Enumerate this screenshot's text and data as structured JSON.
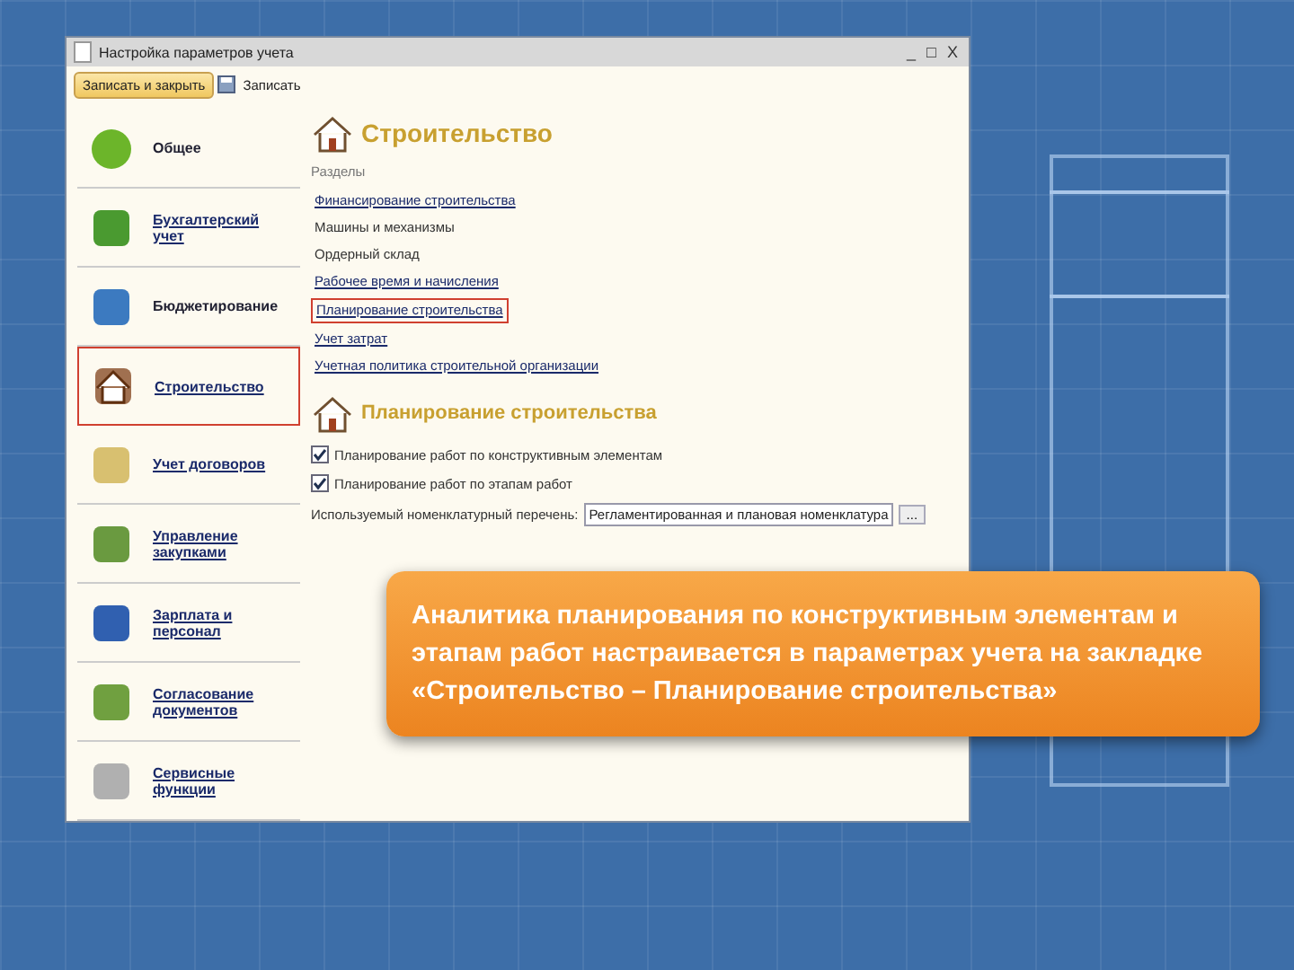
{
  "window": {
    "title": "Настройка параметров учета",
    "controls": [
      "_",
      "□",
      "X"
    ]
  },
  "toolbar": {
    "primary_button": "Записать и закрыть",
    "save_button": "Записать"
  },
  "sidebar": {
    "items": [
      {
        "label": "Общее",
        "link": false,
        "selected": false
      },
      {
        "label": "Бухгалтерский учет",
        "link": true,
        "selected": false
      },
      {
        "label": "Бюджетирование",
        "link": false,
        "selected": false
      },
      {
        "label": "Строительство",
        "link": true,
        "selected": true
      },
      {
        "label": "Учет договоров",
        "link": true,
        "selected": false
      },
      {
        "label": "Управление закупками",
        "link": true,
        "selected": false
      },
      {
        "label": "Зарплата и персонал",
        "link": true,
        "selected": false
      },
      {
        "label": "Согласование документов",
        "link": true,
        "selected": false
      },
      {
        "label": "Сервисные функции",
        "link": true,
        "selected": false
      }
    ]
  },
  "section": {
    "title": "Строительство",
    "subtitle": "Разделы",
    "links": [
      {
        "label": "Финансирование строительства",
        "link": true,
        "selected": false
      },
      {
        "label": "Машины и механизмы",
        "link": false,
        "selected": false
      },
      {
        "label": "Ордерный склад",
        "link": false,
        "selected": false
      },
      {
        "label": "Рабочее время и начисления",
        "link": true,
        "selected": false
      },
      {
        "label": "Планирование строительства",
        "link": true,
        "selected": true
      },
      {
        "label": "Учет затрат",
        "link": true,
        "selected": false
      },
      {
        "label": "Учетная политика строительной организации",
        "link": true,
        "selected": false
      }
    ]
  },
  "planning": {
    "title": "Планирование строительства",
    "checkboxes": [
      {
        "label": "Планирование работ по конструктивным элементам",
        "checked": true
      },
      {
        "label": "Планирование работ по этапам работ",
        "checked": true
      }
    ],
    "field": {
      "label": "Используемый номенклатурный перечень:",
      "value": "Регламентированная и плановая номенклатура",
      "button": "..."
    }
  },
  "callout": {
    "text": "Аналитика планирования по конструктивным элементам и этапам работ настраивается в параметрах учета на закладке «Строительство – Планирование строительства»"
  }
}
